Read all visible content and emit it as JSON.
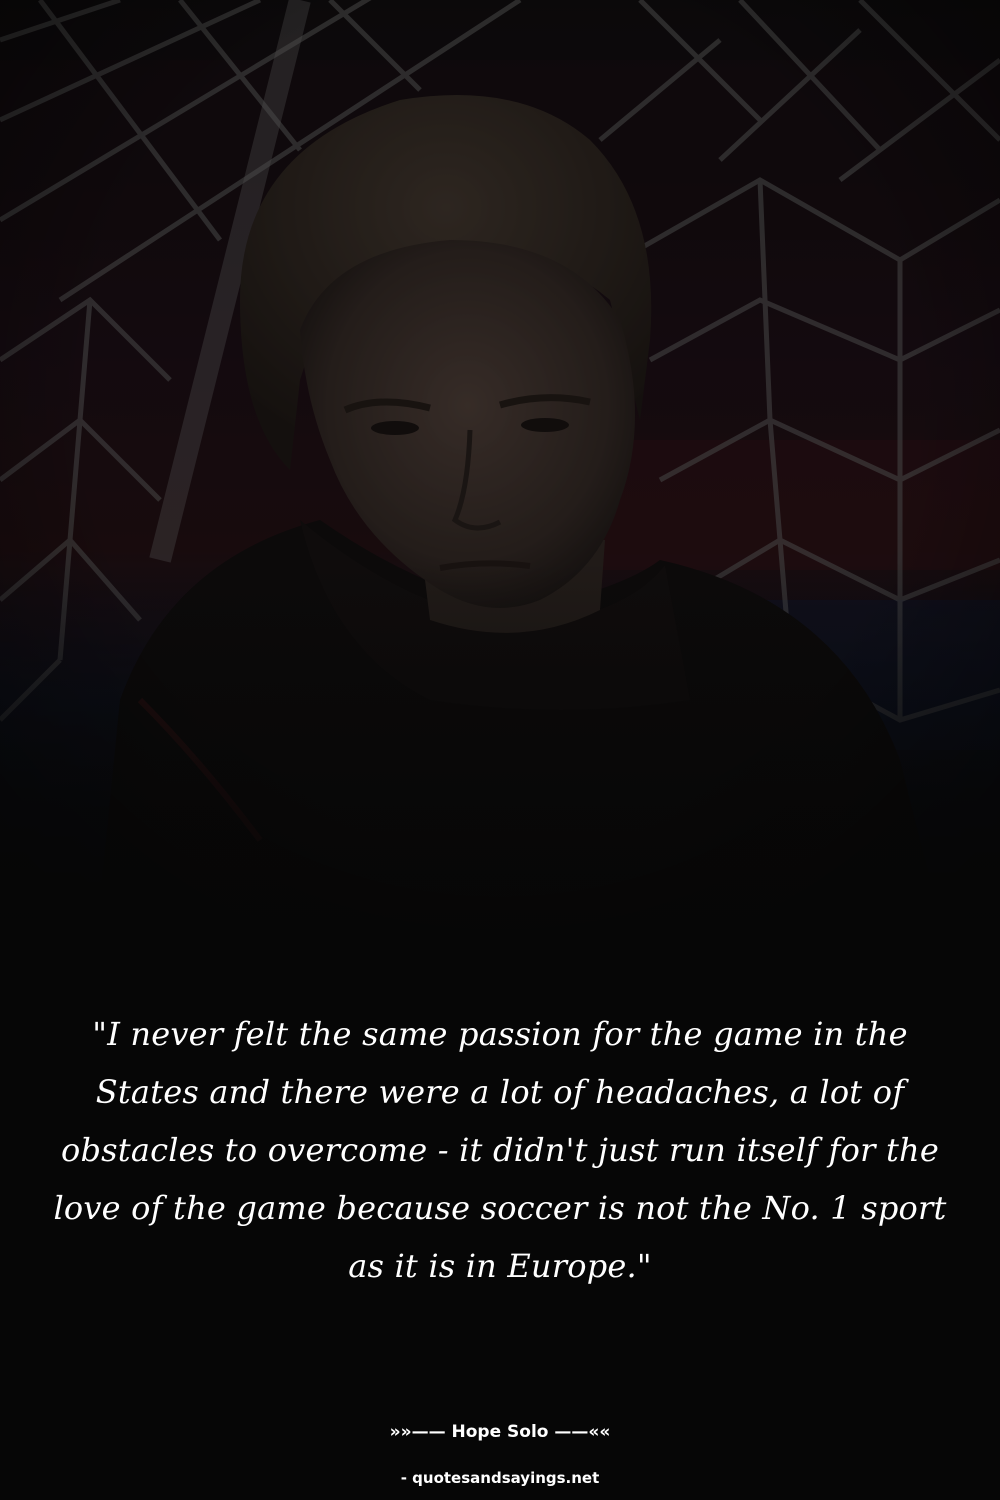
{
  "background_photo": {
    "subject": "soccer goalkeeper in front of goal net",
    "colors": {
      "shadow": "#0d0b0b",
      "stand_red": "#2a1416",
      "stand_blue": "#141a2e",
      "net": "#6e6e6e",
      "skin": "#5a4a42",
      "hair": "#4a3e34",
      "jacket": "#141212"
    }
  },
  "quote": {
    "text": "\"I never felt the same passion for the game in the States and there were a lot of headaches, a lot of obstacles to overcome - it didn't just run itself for the love of the game because soccer is not the No. 1 sport as it is in Europe.\""
  },
  "author": {
    "line": "»»—— Hope Solo ——««"
  },
  "source": {
    "line": "- quotesandsayings.net"
  },
  "colors": {
    "text": "#ffffff",
    "background": "#060606"
  }
}
